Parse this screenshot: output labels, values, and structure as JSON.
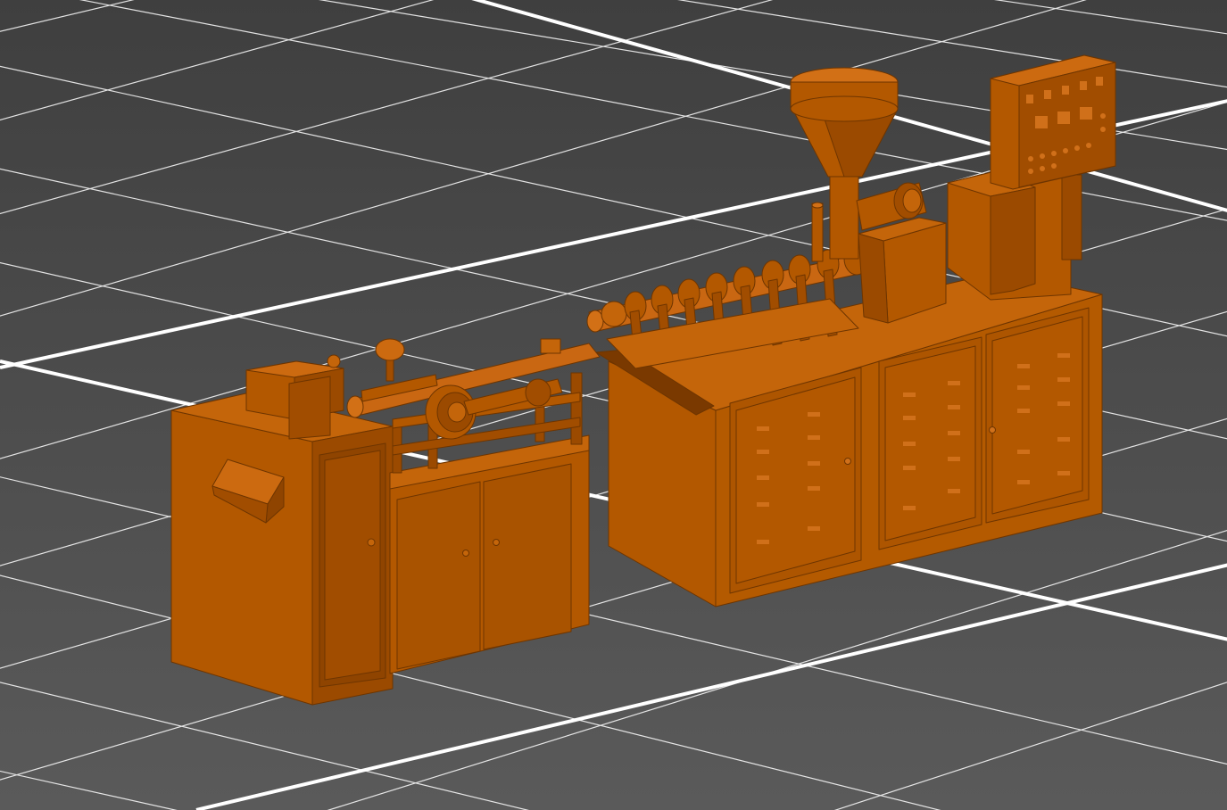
{
  "viewport": {
    "name": "3d-model-viewport",
    "background_color": "#4c4c4c",
    "grid": {
      "visible": true,
      "minor_line_color": "#ffffff",
      "major_line_color": "#ffffff"
    },
    "model": {
      "name": "extruder-machine-model",
      "color": "#b85a00",
      "parts": [
        "cooling-tank-cabinet",
        "feed-roller-assembly",
        "extruder-base-cabinet",
        "hopper",
        "barrel-with-heater-bands",
        "gearbox",
        "drive-motor",
        "control-panel"
      ]
    }
  }
}
